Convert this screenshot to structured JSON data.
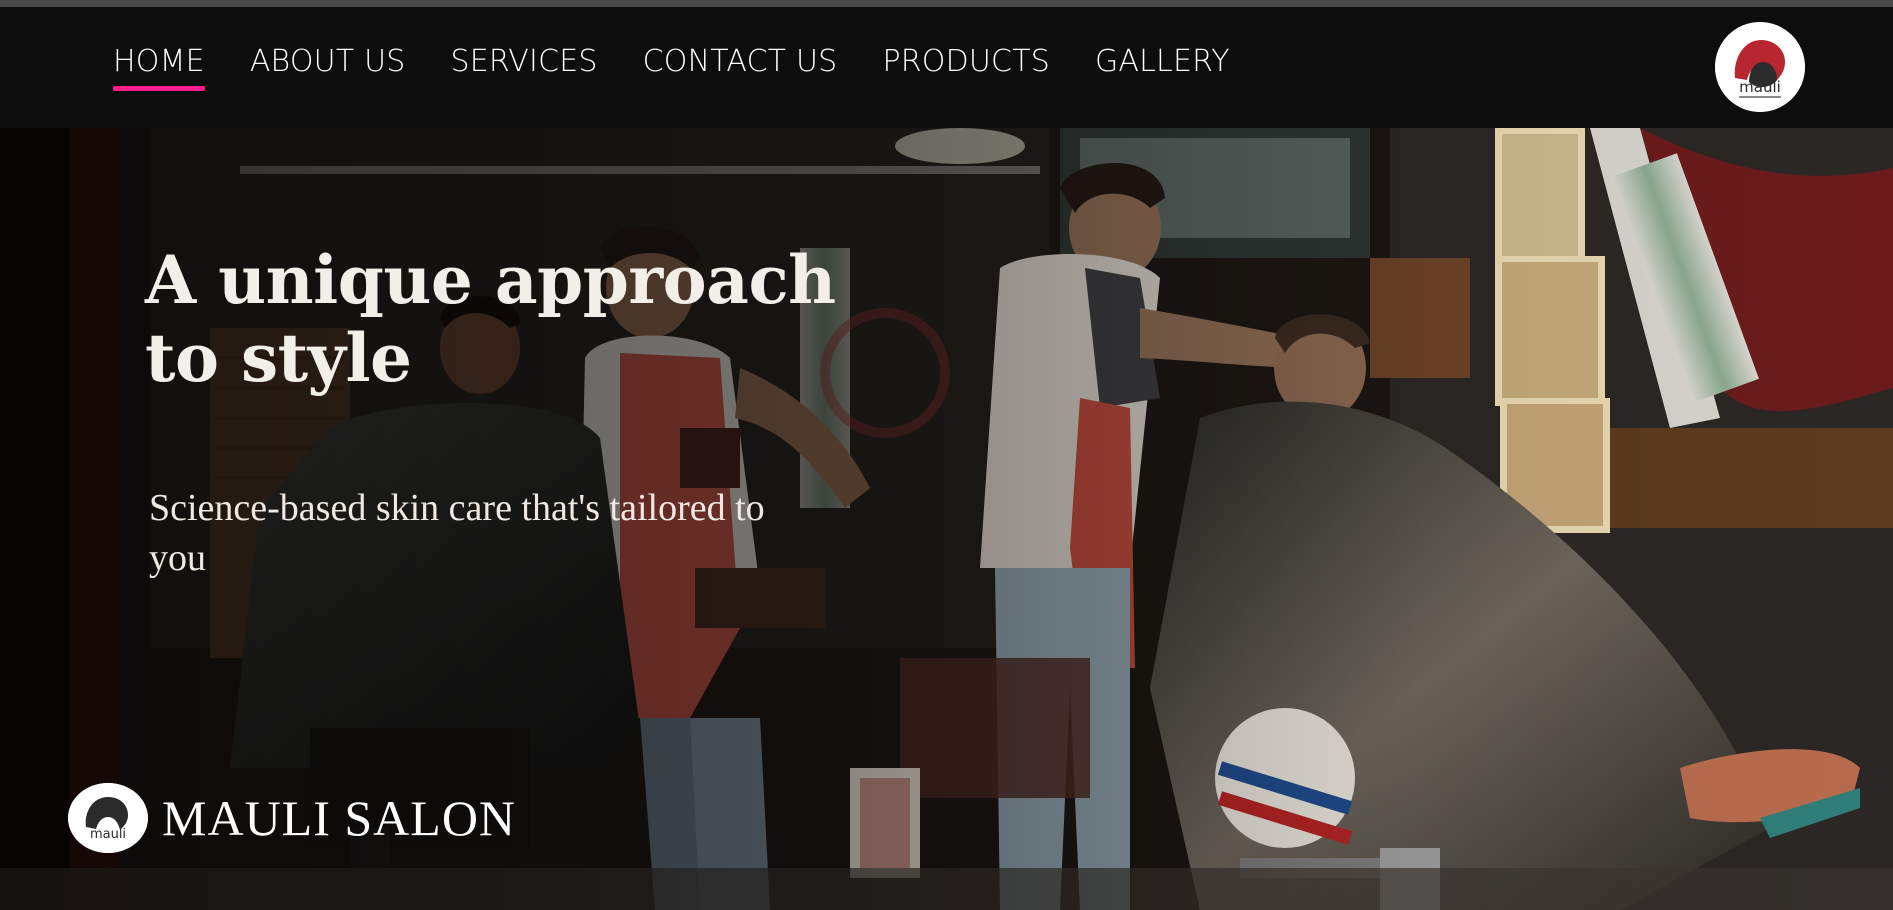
{
  "nav": {
    "items": [
      {
        "label": "HOME",
        "active": true
      },
      {
        "label": "ABOUT US",
        "active": false
      },
      {
        "label": "SERVICES",
        "active": false
      },
      {
        "label": "CONTACT US",
        "active": false
      },
      {
        "label": "PRODUCTS",
        "active": false
      },
      {
        "label": "GALLERY",
        "active": false
      }
    ],
    "logo_text": "mauli"
  },
  "hero": {
    "headline": "A unique approach to style",
    "subheadline": "Science-based skin care that's tailored to you",
    "brand_logo_text": "mauli",
    "brand_name": "MAULI SALON"
  },
  "colors": {
    "accent": "#ff1c8d",
    "nav_background": "#0d0d0d",
    "text": "#ffffff"
  }
}
